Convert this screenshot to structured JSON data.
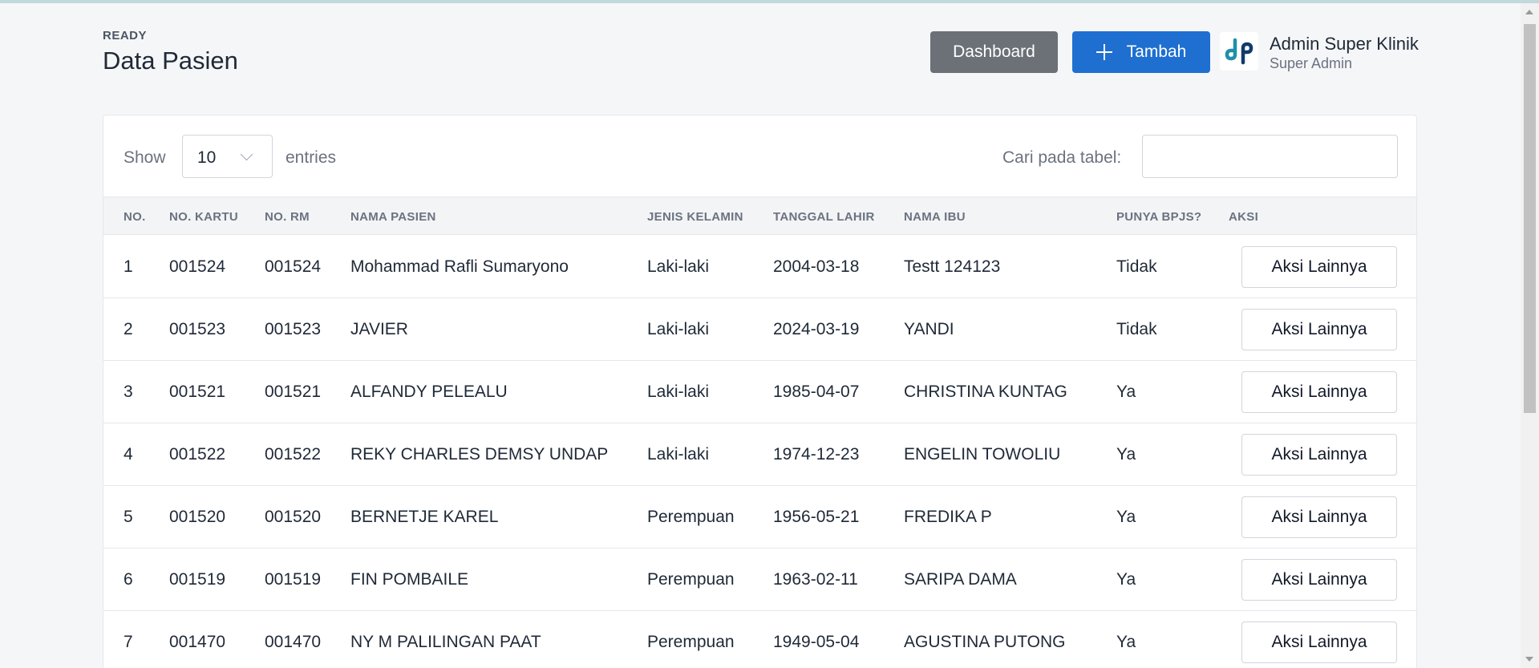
{
  "header": {
    "status": "READY",
    "title": "Data Pasien",
    "dashboard_label": "Dashboard",
    "add_label": "Tambah",
    "user_name": "Admin Super Klinik",
    "user_role": "Super Admin"
  },
  "table_controls": {
    "show_label": "Show",
    "page_length": "10",
    "entries_label": "entries",
    "search_label": "Cari pada tabel:",
    "search_value": ""
  },
  "columns": [
    "NO.",
    "NO. KARTU",
    "NO. RM",
    "NAMA PASIEN",
    "JENIS KELAMIN",
    "TANGGAL LAHIR",
    "NAMA IBU",
    "PUNYA BPJS?",
    "AKSI"
  ],
  "rows": [
    {
      "no": "1",
      "kartu": "001524",
      "rm": "001524",
      "nama": "Mohammad Rafli Sumaryono",
      "jk": "Laki-laki",
      "lahir": "2004-03-18",
      "ibu": "Testt 124123",
      "bpjs": "Tidak",
      "aksi": "Aksi Lainnya"
    },
    {
      "no": "2",
      "kartu": "001523",
      "rm": "001523",
      "nama": "JAVIER",
      "jk": "Laki-laki",
      "lahir": "2024-03-19",
      "ibu": "YANDI",
      "bpjs": "Tidak",
      "aksi": "Aksi Lainnya"
    },
    {
      "no": "3",
      "kartu": "001521",
      "rm": "001521",
      "nama": "ALFANDY PELEALU",
      "jk": "Laki-laki",
      "lahir": "1985-04-07",
      "ibu": "CHRISTINA KUNTAG",
      "bpjs": "Ya",
      "aksi": "Aksi Lainnya"
    },
    {
      "no": "4",
      "kartu": "001522",
      "rm": "001522",
      "nama": "REKY CHARLES DEMSY UNDAP",
      "jk": "Laki-laki",
      "lahir": "1974-12-23",
      "ibu": "ENGELIN TOWOLIU",
      "bpjs": "Ya",
      "aksi": "Aksi Lainnya"
    },
    {
      "no": "5",
      "kartu": "001520",
      "rm": "001520",
      "nama": "BERNETJE KAREL",
      "jk": "Perempuan",
      "lahir": "1956-05-21",
      "ibu": "FREDIKA P",
      "bpjs": "Ya",
      "aksi": "Aksi Lainnya"
    },
    {
      "no": "6",
      "kartu": "001519",
      "rm": "001519",
      "nama": "FIN POMBAILE",
      "jk": "Perempuan",
      "lahir": "1963-02-11",
      "ibu": "SARIPA DAMA",
      "bpjs": "Ya",
      "aksi": "Aksi Lainnya"
    },
    {
      "no": "7",
      "kartu": "001470",
      "rm": "001470",
      "nama": "NY M PALILINGAN PAAT",
      "jk": "Perempuan",
      "lahir": "1949-05-04",
      "ibu": "AGUSTINA PUTONG",
      "bpjs": "Ya",
      "aksi": "Aksi Lainnya"
    }
  ],
  "colors": {
    "primary": "#1f6fd0",
    "secondary": "#6b7177",
    "logo_teal": "#1e90a8",
    "logo_navy": "#123a6b"
  }
}
